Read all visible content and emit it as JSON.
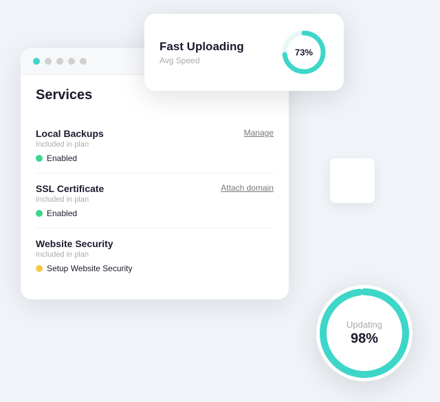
{
  "upload_card": {
    "title": "Fast Uploading",
    "subtitle": "Avg Speed",
    "percent": "73%",
    "percent_value": 73
  },
  "services_card": {
    "title": "Services",
    "items": [
      {
        "name": "Local Backups",
        "plan": "Included in plan",
        "status": "Enabled",
        "status_type": "green",
        "action": "Manage"
      },
      {
        "name": "SSL Certificate",
        "plan": "Included in plan",
        "status": "Enabled",
        "status_type": "green",
        "action": "Attach domain"
      },
      {
        "name": "Website Security",
        "plan": "Included in plan",
        "status": "Setup Website Security",
        "status_type": "yellow",
        "action": ""
      }
    ]
  },
  "updating_circle": {
    "label": "Updating",
    "percent": "98%",
    "percent_value": 98
  }
}
